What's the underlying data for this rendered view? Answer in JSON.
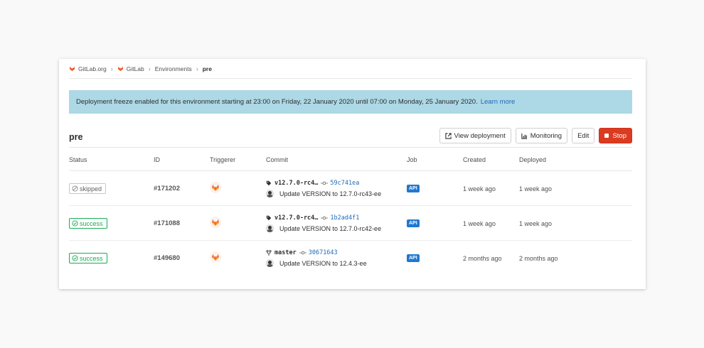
{
  "breadcrumb": {
    "items": [
      "GitLab.org",
      "GitLab",
      "Environments",
      "pre"
    ],
    "separator": "›"
  },
  "alert": {
    "text": "Deployment freeze enabled for this environment starting at 23:00 on Friday, 22 January 2020 until 07:00 on Monday, 25 January 2020.",
    "link": "Learn more"
  },
  "environment": {
    "name": "pre",
    "buttons": {
      "view_deployment": "View deployment",
      "monitoring": "Monitoring",
      "edit": "Edit",
      "stop": "Stop"
    }
  },
  "table": {
    "headers": {
      "status": "Status",
      "id": "ID",
      "triggerer": "Triggerer",
      "commit": "Commit",
      "job": "Job",
      "created": "Created",
      "deployed": "Deployed"
    },
    "rows": [
      {
        "status": "skipped",
        "id": "#171202",
        "ref_type": "tag",
        "ref": "v12.7.0-rc4…",
        "sha": "59c741ea",
        "message": "Update VERSION to 12.7.0-rc43-ee",
        "job": "API",
        "created": "1 week ago",
        "deployed": "1 week ago"
      },
      {
        "status": "success",
        "id": "#171088",
        "ref_type": "tag",
        "ref": "v12.7.0-rc4…",
        "sha": "1b2ad4f1",
        "message": "Update VERSION to 12.7.0-rc42-ee",
        "job": "API",
        "created": "1 week ago",
        "deployed": "1 week ago"
      },
      {
        "status": "success",
        "id": "#149680",
        "ref_type": "branch",
        "ref": "master",
        "sha": "30671643",
        "message": "Update VERSION to 12.4.3-ee",
        "job": "API",
        "created": "2 months ago",
        "deployed": "2 months ago"
      }
    ]
  },
  "colors": {
    "alert_bg": "#add8e6",
    "link": "#1f6ab7",
    "success": "#1aaa55",
    "danger": "#db3b21",
    "job_badge": "#1f78d1"
  }
}
